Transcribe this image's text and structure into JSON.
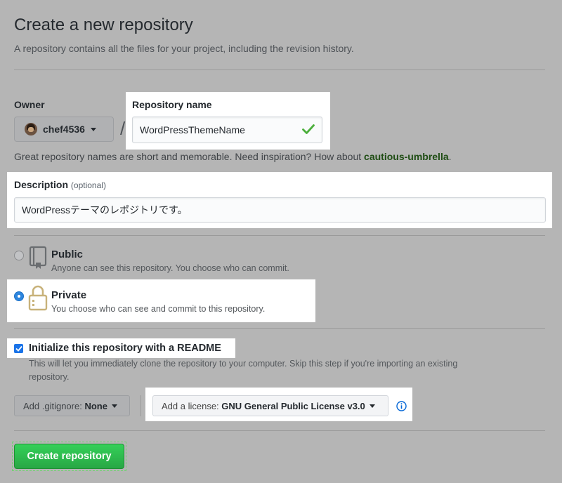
{
  "header": {
    "title": "Create a new repository",
    "subtitle": "A repository contains all the files for your project, including the revision history."
  },
  "owner": {
    "label": "Owner",
    "username": "chef4536"
  },
  "repo_name": {
    "label": "Repository name",
    "value": "WordPressThemeName"
  },
  "helper": {
    "text": "Great repository names are short and memorable. Need inspiration? How about",
    "suggestion": "cautious-umbrella",
    "period": "."
  },
  "description": {
    "label": "Description",
    "optional": "(optional)",
    "value": "WordPressテーマのレポジトリです。"
  },
  "visibility": {
    "public": {
      "title": "Public",
      "desc": "Anyone can see this repository. You choose who can commit.",
      "selected": false
    },
    "private": {
      "title": "Private",
      "desc": "You choose who can see and commit to this repository.",
      "selected": true
    }
  },
  "readme": {
    "label": "Initialize this repository with a README",
    "desc_line1": "This will let you immediately clone the repository to your computer. Skip this step if you're importing an existing",
    "desc_line2": "repository.",
    "checked": true
  },
  "gitignore": {
    "prefix": "Add .gitignore:",
    "value": "None"
  },
  "license": {
    "prefix": "Add a license:",
    "value": "GNU General Public License v3.0"
  },
  "submit": {
    "label": "Create repository"
  },
  "colors": {
    "accent_green": "#28a745",
    "radio_blue": "#2e86de",
    "check_green": "#4caf3c",
    "info_blue": "#0366d6"
  }
}
